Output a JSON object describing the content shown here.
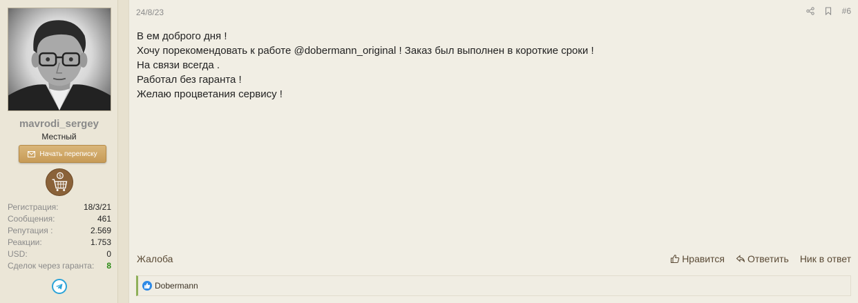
{
  "user": {
    "username": "mavrodi_sergey",
    "title": "Местный",
    "start_conversation_label": "Начать переписку",
    "avatar_icon": "user-avatar-photo",
    "badge_icon": "shopping-cart-dollar-badge",
    "stats": [
      {
        "label": "Регистрация:",
        "value": "18/3/21"
      },
      {
        "label": "Сообщения:",
        "value": "461"
      },
      {
        "label": "Репутация :",
        "value": "2.569"
      },
      {
        "label": "Реакции:",
        "value": "1.753"
      },
      {
        "label": "USD:",
        "value": "0"
      },
      {
        "label": "Сделок через гаранта:",
        "value": "8"
      }
    ],
    "social_icon": "telegram-icon"
  },
  "post": {
    "date": "24/8/23",
    "number": "#6",
    "lines": [
      "В ем доброго дня !",
      "Хочу порекомендовать к работе @dobermann_original ! Заказ был выполнен в короткие сроки !",
      "На связи всегда .",
      "Работал без гаранта !",
      "Желаю процветания сервису !"
    ],
    "report_label": "Жалоба",
    "like_label": "Нравится",
    "reply_label": "Ответить",
    "nick_reply_label": "Ник в ответ",
    "reactions": {
      "users": "Dobermann",
      "icon": "like-reaction-icon"
    }
  },
  "colors": {
    "accent_button": "#c79b57",
    "success": "#2a8a14",
    "reaction_blue": "#2e8ae6",
    "telegram": "#2aa3d8"
  }
}
